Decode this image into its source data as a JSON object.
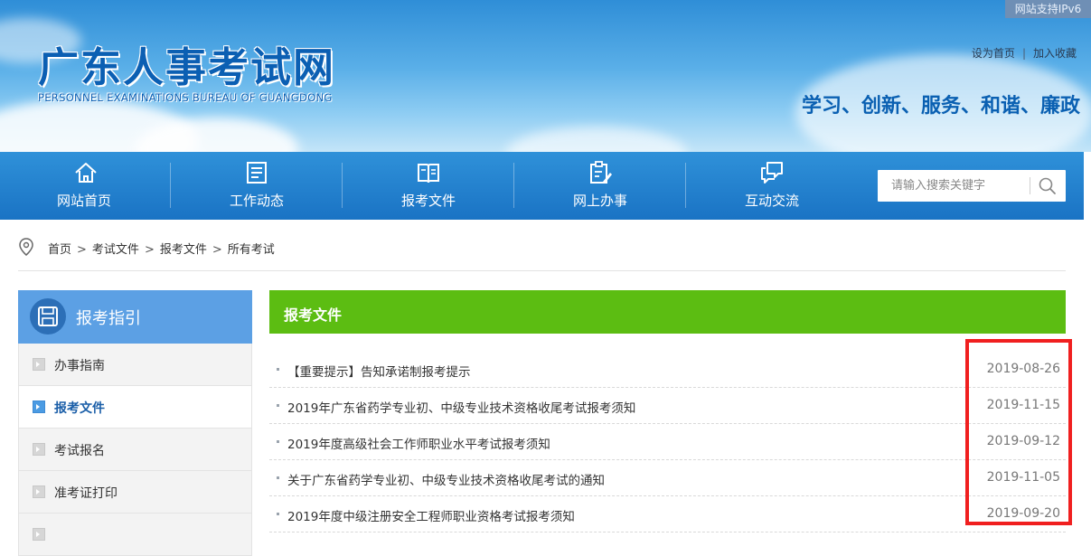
{
  "header": {
    "ipv6_badge": "网站支持IPv6",
    "logo_cn": "广东人事考试网",
    "logo_en": "PERSONNEL EXAMINATIONS BUREAU OF GUANGDONG",
    "set_home": "设为首页",
    "separator": "|",
    "add_favorite": "加入收藏",
    "slogan": "学习、创新、服务、和谐、廉政",
    "colors": {
      "nav": "#1a73c4",
      "logo": "#0b5fb3"
    }
  },
  "nav": {
    "items": [
      {
        "label": "网站首页",
        "icon": "home-icon"
      },
      {
        "label": "工作动态",
        "icon": "news-icon"
      },
      {
        "label": "报考文件",
        "icon": "book-icon"
      },
      {
        "label": "网上办事",
        "icon": "form-edit-icon"
      },
      {
        "label": "互动交流",
        "icon": "chat-icon"
      }
    ],
    "search_placeholder": "请输入搜索关键字"
  },
  "breadcrumb": {
    "items": [
      "首页",
      "考试文件",
      "报考文件",
      "所有考试"
    ],
    "separator": ">"
  },
  "sidebar": {
    "title": "报考指引",
    "items": [
      {
        "label": "办事指南",
        "active": false
      },
      {
        "label": "报考文件",
        "active": true
      },
      {
        "label": "考试报名",
        "active": false
      },
      {
        "label": "准考证打印",
        "active": false
      }
    ]
  },
  "main": {
    "section_title": "报考文件",
    "accent": "#5cbd12",
    "highlight_color": "#f01f1f",
    "articles": [
      {
        "title": "【重要提示】告知承诺制报考提示",
        "date": "2019-08-26"
      },
      {
        "title": "2019年广东省药学专业初、中级专业技术资格收尾考试报考须知",
        "date": "2019-11-15"
      },
      {
        "title": "2019年度高级社会工作师职业水平考试报考须知",
        "date": "2019-09-12"
      },
      {
        "title": "关于广东省药学专业初、中级专业技术资格收尾考试的通知",
        "date": "2019-11-05"
      },
      {
        "title": "2019年度中级注册安全工程师职业资格考试报考须知",
        "date": "2019-09-20"
      }
    ]
  }
}
